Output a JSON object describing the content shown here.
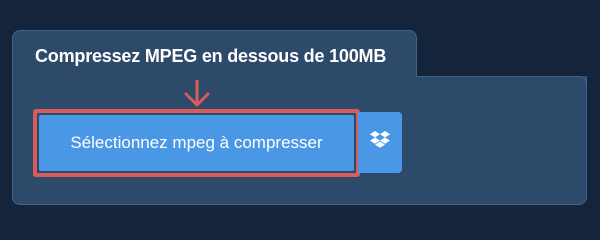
{
  "upload": {
    "title": "Compressez MPEG en dessous de 100MB",
    "select_button_label": "Sélectionnez mpeg à compresser",
    "dropbox_icon": "dropbox-icon",
    "arrow_icon": "arrow-down-icon"
  },
  "colors": {
    "page_background": "#14243a",
    "panel_background": "#2d4a6b",
    "panel_border": "#40648b",
    "button_background": "#4a97e6",
    "highlight": "#d85c5c"
  }
}
